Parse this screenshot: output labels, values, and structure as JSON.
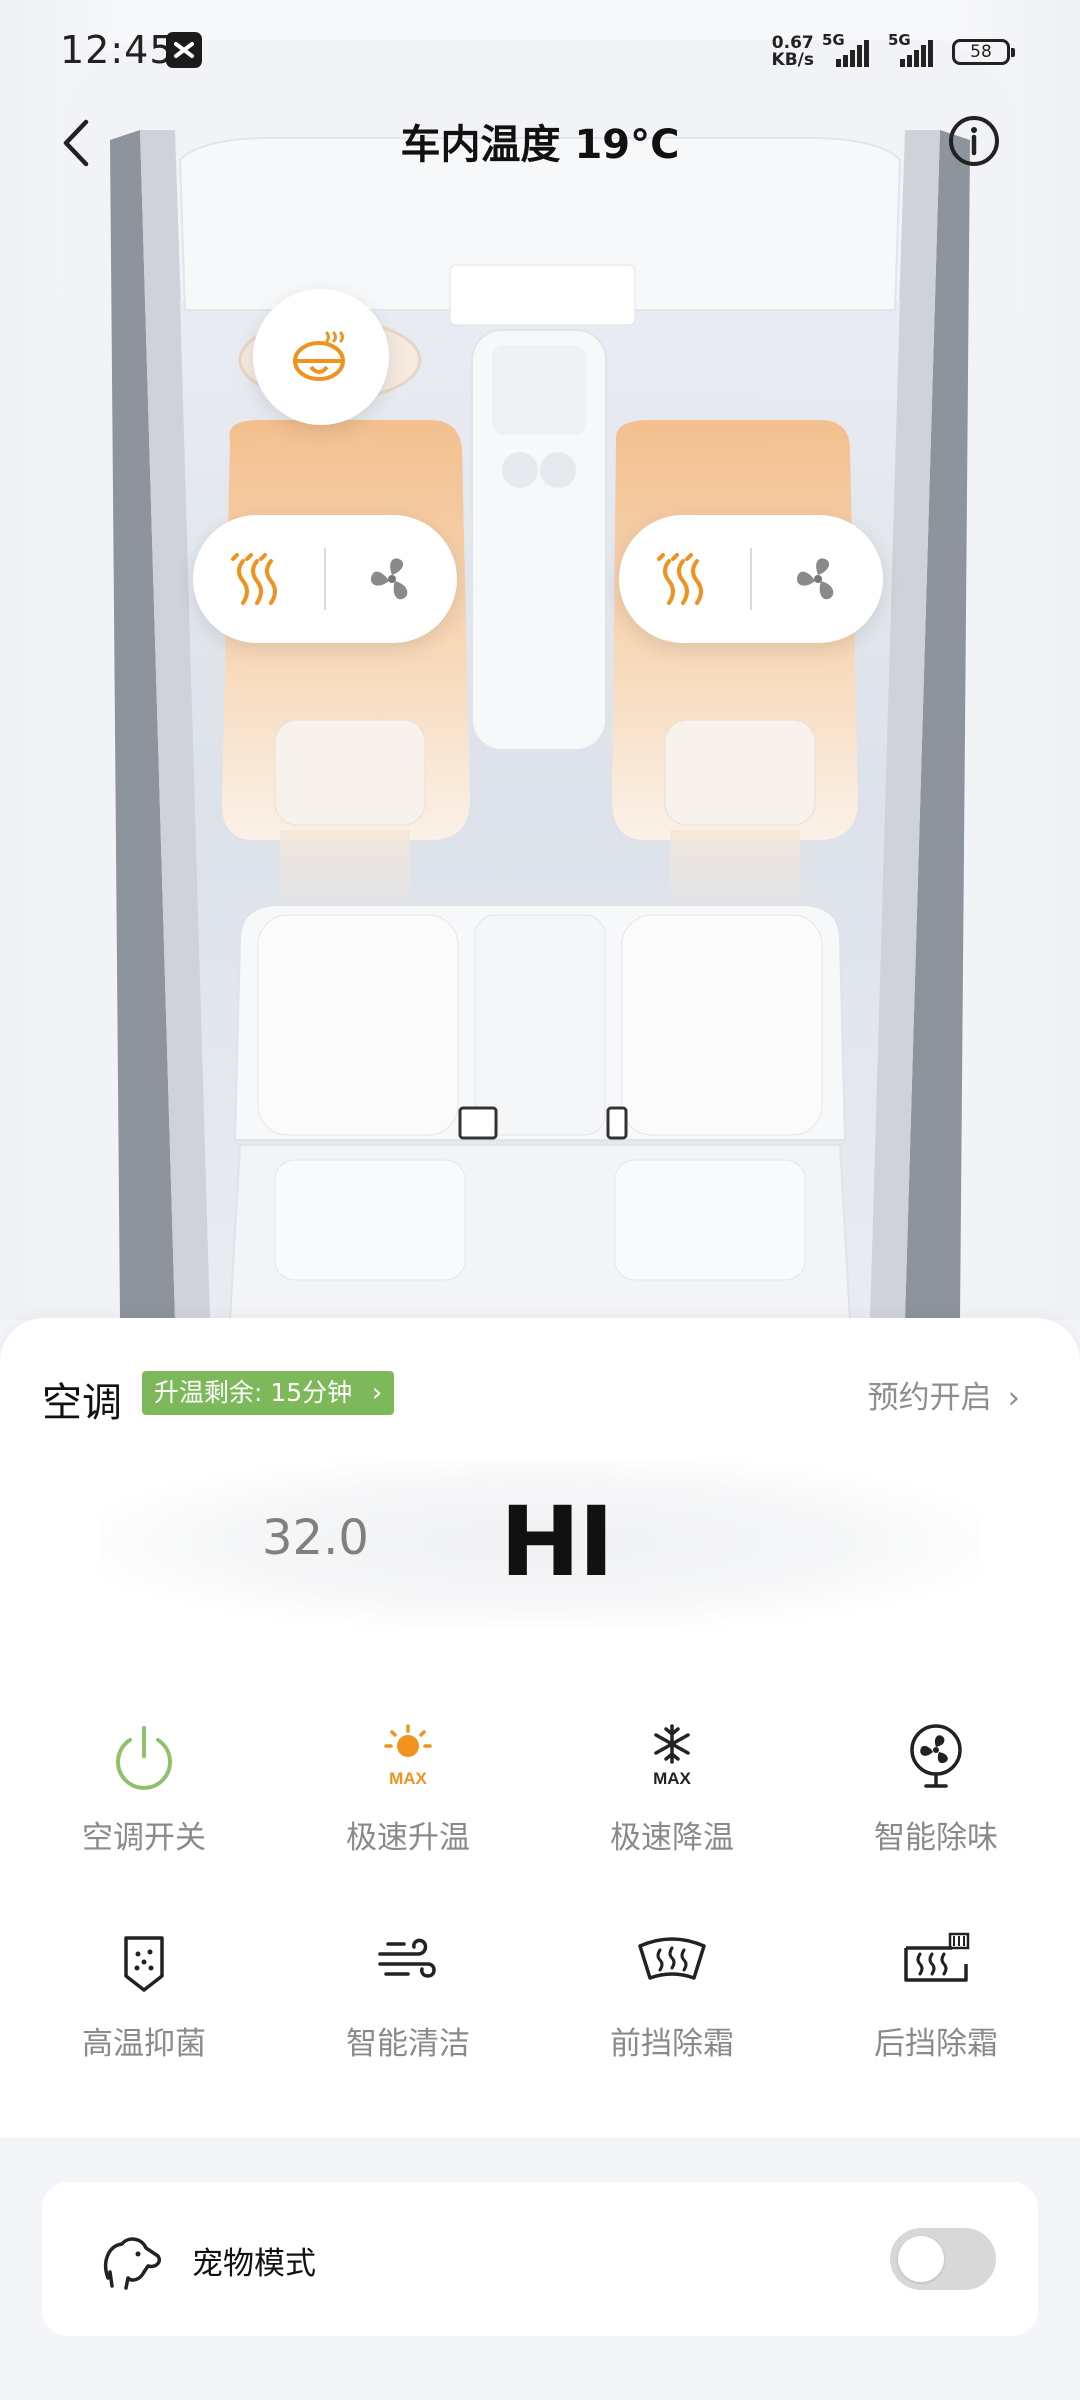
{
  "status_bar": {
    "time": "12:45",
    "net_speed_value": "0.67",
    "net_speed_unit": "KB/s",
    "signal1_label": "5G",
    "signal2_label": "5G",
    "battery": "58"
  },
  "header": {
    "title": "车内温度 19°C"
  },
  "ac": {
    "title": "空调",
    "heating_badge": "升温剩余: 15分钟",
    "schedule_label": "预约开启",
    "temp_previous": "32.0",
    "temp_current": "HI",
    "functions": [
      {
        "label": "空调开关",
        "icon": "power-icon"
      },
      {
        "label": "极速升温",
        "icon": "sun-max-icon"
      },
      {
        "label": "极速降温",
        "icon": "snowflake-max-icon"
      },
      {
        "label": "智能除味",
        "icon": "fan-icon"
      },
      {
        "label": "高温抑菌",
        "icon": "shield-icon"
      },
      {
        "label": "智能清洁",
        "icon": "wind-icon"
      },
      {
        "label": "前挡除霜",
        "icon": "front-defrost-icon"
      },
      {
        "label": "后挡除霜",
        "icon": "rear-defrost-icon"
      }
    ]
  },
  "pet_mode": {
    "label": "宠物模式",
    "enabled": false
  },
  "colors": {
    "heat_orange": "#f0921d",
    "badge_green": "#7db85a",
    "power_green": "#8fc16a"
  }
}
